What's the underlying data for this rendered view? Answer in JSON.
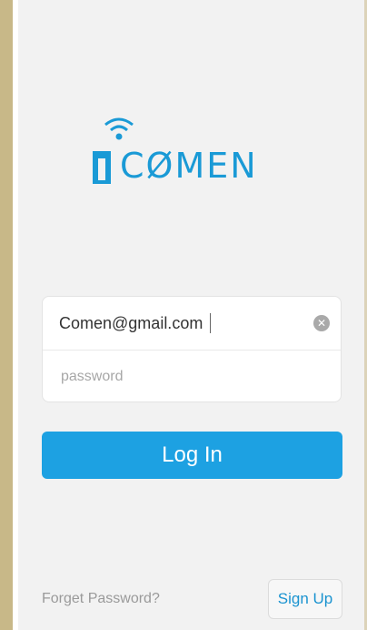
{
  "brand": {
    "name": "CØMEN",
    "accent_color": "#1a9ad6",
    "icon": "wifi-signal-icon"
  },
  "login_form": {
    "email_value": "Comen@gmail.com",
    "password_placeholder": "password",
    "clear_icon": "clear-input-icon",
    "clear_glyph": "✕"
  },
  "actions": {
    "login_label": "Log In",
    "login_color": "#1da1e2",
    "forget_password_label": "Forget Password?",
    "signup_label": "Sign Up"
  }
}
